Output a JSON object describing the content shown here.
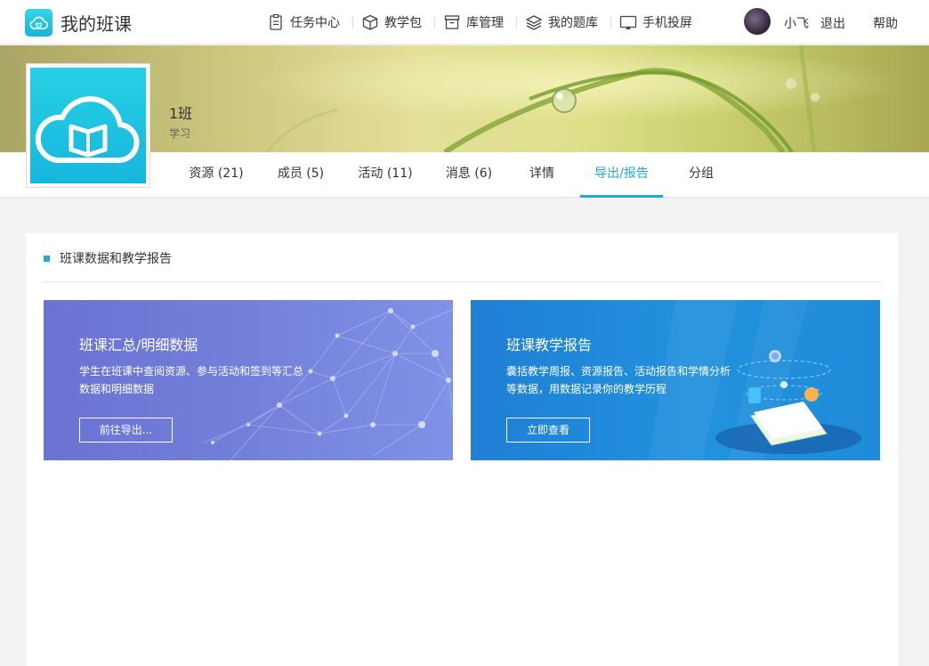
{
  "header": {
    "app_title": "我的班课",
    "nav": [
      {
        "label": "任务中心",
        "icon": "clipboard-icon"
      },
      {
        "label": "教学包",
        "icon": "package-icon"
      },
      {
        "label": "库管理",
        "icon": "archive-icon"
      },
      {
        "label": "我的题库",
        "icon": "layers-icon"
      },
      {
        "label": "手机投屏",
        "icon": "cast-icon"
      }
    ],
    "user_name": "小飞",
    "logout": "退出",
    "help": "帮助"
  },
  "class_info": {
    "name": "1班",
    "subtitle": "学习"
  },
  "tabs": [
    {
      "label": "资源 (21)"
    },
    {
      "label": "成员 (5)"
    },
    {
      "label": "活动 (11)"
    },
    {
      "label": "消息 (6)"
    },
    {
      "label": "详情"
    },
    {
      "label": "导出/报告",
      "active": true
    },
    {
      "label": "分组"
    }
  ],
  "section": {
    "title": "班课数据和教学报告"
  },
  "cards": [
    {
      "title": "班课汇总/明细数据",
      "description": "学生在班课中查阅资源、参与活动和签到等汇总数据和明细数据",
      "button": "前往导出..."
    },
    {
      "title": "班课教学报告",
      "description": "囊括教学周报、资源报告、活动报告和学情分析等数据，用数据记录你的教学历程",
      "button": "立即查看"
    }
  ],
  "colors": {
    "accent": "#23a8d1",
    "card_left": "#717cd8",
    "card_right": "#2088d8"
  }
}
